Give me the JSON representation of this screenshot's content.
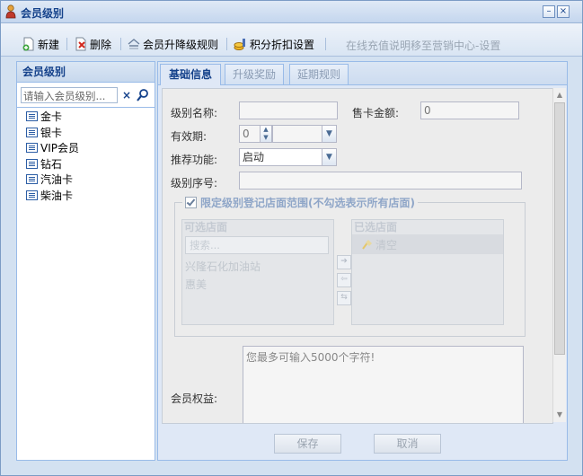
{
  "window": {
    "title": "会员级别",
    "minimize_label": "–",
    "close_label": "×"
  },
  "toolbar": {
    "new_label": "新建",
    "delete_label": "删除",
    "upgrade_rules_label": "会员升降级规则",
    "points_discount_label": "积分折扣设置",
    "note": "在线充值说明移至营销中心-设置"
  },
  "sidebar": {
    "title": "会员级别",
    "search_placeholder": "请输入会员级别...",
    "clear_label": "×",
    "items": [
      {
        "label": "金卡"
      },
      {
        "label": "银卡"
      },
      {
        "label": "VIP会员"
      },
      {
        "label": "钻石"
      },
      {
        "label": "汽油卡"
      },
      {
        "label": "柴油卡"
      }
    ]
  },
  "tabs": [
    {
      "label": "基础信息",
      "active": true
    },
    {
      "label": "升级奖励",
      "active": false
    },
    {
      "label": "延期规则",
      "active": false
    }
  ],
  "form": {
    "level_name_label": "级别名称:",
    "level_name_value": "",
    "card_price_label": "售卡金额:",
    "card_price_value": "0",
    "validity_label": "有效期:",
    "validity_value": "0",
    "validity_unit_value": "",
    "recommend_label": "推荐功能:",
    "recommend_value": "启动",
    "sequence_label": "级别序号:",
    "sequence_value": "",
    "store_limit_label": "限定级别登记店面范围(不勾选表示所有店面)",
    "store_limit_checked": true,
    "available_stores_title": "可选店面",
    "available_search_placeholder": "搜索...",
    "available_stores": [
      "兴隆石化加油站",
      "惠美"
    ],
    "selected_stores_title": "已选店面",
    "clear_selected_label": "清空",
    "benefits_label": "会员权益:",
    "benefits_placeholder": "您最多可输入5000个字符!"
  },
  "footer": {
    "save_label": "保存",
    "cancel_label": "取消"
  },
  "colors": {
    "title_text": "#15428b",
    "panel_border": "#99bbe8",
    "window_bg": "#d3e1f1"
  }
}
